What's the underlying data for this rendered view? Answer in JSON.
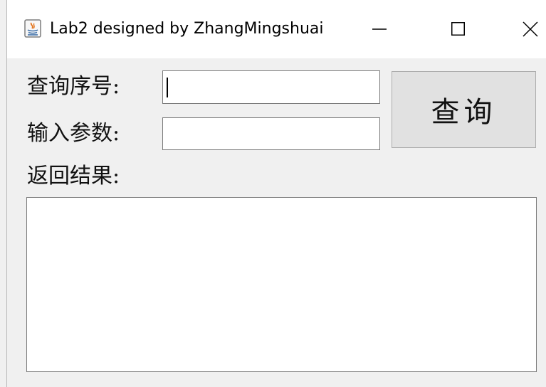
{
  "window": {
    "title": "Lab2 designed by ZhangMingshuai",
    "controls": {
      "minimize_icon": "minimize-icon",
      "maximize_icon": "maximize-icon",
      "close_icon": "close-icon"
    },
    "app_icon": "java-app-icon"
  },
  "form": {
    "query_seq_label": "查询序号:",
    "query_seq_value": "",
    "input_param_label": "输入参数:",
    "input_param_value": "",
    "query_button_label": "查询",
    "result_label": "返回结果:",
    "result_value": ""
  },
  "colors": {
    "background": "#f0f0f0",
    "titlebar": "#ffffff",
    "button_face": "#e1e1e1",
    "field_border": "#7a7a7a"
  }
}
